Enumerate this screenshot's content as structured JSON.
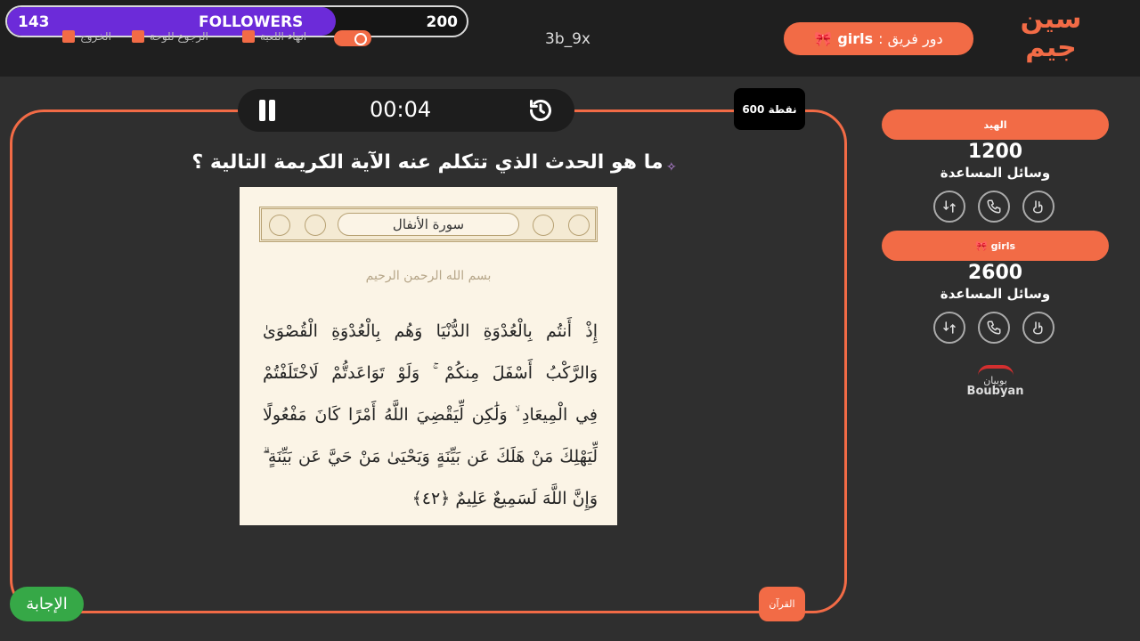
{
  "followers": {
    "current": "143",
    "label": "FOLLOWERS",
    "goal": "200",
    "progress_fraction": 0.715
  },
  "top_links": [
    "انهاء اللعبة",
    "الرجوع للوحة",
    "الخروج"
  ],
  "game_code": "3b_9x",
  "turn": {
    "prefix": "دور فريق :",
    "team": "girls",
    "icon": "ribbon-icon"
  },
  "logo_text": [
    "سين",
    "جيم"
  ],
  "timer": {
    "time": "00:04"
  },
  "points": "600 نقطة",
  "question": "ما هو الحدث الذي تتكلم عنه الآية الكريمة التالية ؟",
  "verse_image": {
    "surah_title": "سورة الأنفال",
    "bismillah": "بسم الله الرحمن الرحيم",
    "lines": [
      "إِذْ أَنتُم بِالْعُدْوَةِ الدُّنْيَا وَهُم بِالْعُدْوَةِ الْقُصْوَىٰ",
      "وَالرَّكْبُ أَسْفَلَ مِنكُمْ ۚ وَلَوْ تَوَاعَدتُّمْ لَاخْتَلَفْتُمْ",
      "فِي الْمِيعَادِ ۙ وَلَٰكِن لِّيَقْضِيَ اللَّهُ أَمْرًا كَانَ مَفْعُولًا",
      "لِّيَهْلِكَ مَنْ هَلَكَ عَن بَيِّنَةٍ وَيَحْيَىٰ مَنْ حَيَّ عَن بَيِّنَةٍ ۗ",
      "وَإِنَّ اللَّهَ لَسَمِيعٌ عَلِيمٌ ﴿٤٢﴾"
    ]
  },
  "buttons": {
    "answer": "الإجابة",
    "category": "القرآن"
  },
  "teams": [
    {
      "name": "الهيد",
      "score": "1200",
      "aids_label": "وسائل المساعدة"
    },
    {
      "name": "girls",
      "icon": "ribbon-icon",
      "score": "2600",
      "aids_label": "وسائل المساعدة"
    }
  ],
  "sponsor": {
    "arabic": "بوبيان",
    "english": "Boubyan"
  },
  "colors": {
    "accent": "#f26b46",
    "progress": "#6c2bd9",
    "answer": "#36a847",
    "background": "#2f2f2f",
    "topbar": "#1f1f1f"
  }
}
